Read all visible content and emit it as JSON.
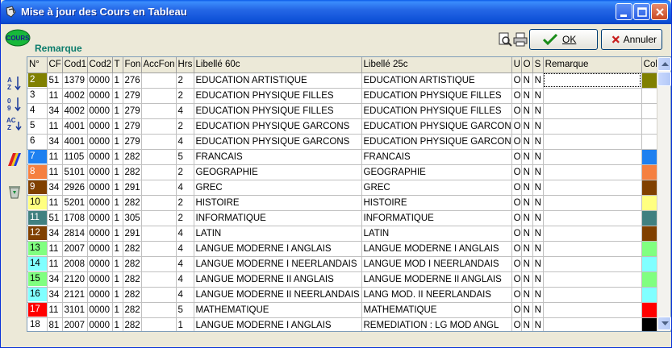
{
  "window": {
    "title": "Mise à jour des Cours en Tableau",
    "logo_text": "COURS",
    "section_label": "Remarque"
  },
  "toolbar": {
    "ok_label": "OK",
    "cancel_label": "Annuler",
    "preview_icon": "print-preview-icon",
    "print_icon": "printer-icon"
  },
  "side_tools": [
    {
      "name": "sort-alpha-icon"
    },
    {
      "name": "sort-numeric-icon"
    },
    {
      "name": "sort-ac-icon"
    },
    {
      "name": "color-palette-icon"
    },
    {
      "name": "recycle-bin-icon"
    }
  ],
  "columns": [
    "N°",
    "CF",
    "Cod1",
    "Cod2",
    "T",
    "Fon",
    "AccFon",
    "Hrs",
    "Libellé 60c",
    "Libellé 25c",
    "U",
    "O",
    "S",
    "Remarque",
    "Col"
  ],
  "rows": [
    {
      "n": "2",
      "cf": "51",
      "cod1": "1379",
      "cod2": "0000",
      "t": "1",
      "fon": "276",
      "accfon": "",
      "hrs": "2",
      "lib60": "EDUCATION ARTISTIQUE",
      "lib25": "EDUCATION ARTISTIQUE",
      "u": "O",
      "o": "N",
      "s": "N",
      "remarque": "",
      "color": "#808000",
      "ntext": "#ffffff"
    },
    {
      "n": "3",
      "cf": "11",
      "cod1": "4002",
      "cod2": "0000",
      "t": "1",
      "fon": "279",
      "accfon": "",
      "hrs": "2",
      "lib60": "EDUCATION PHYSIQUE FILLES",
      "lib25": "EDUCATION PHYSIQUE FILLES",
      "u": "O",
      "o": "N",
      "s": "N",
      "remarque": "",
      "color": "#ffffff",
      "ntext": "#000000"
    },
    {
      "n": "4",
      "cf": "34",
      "cod1": "4002",
      "cod2": "0000",
      "t": "1",
      "fon": "279",
      "accfon": "",
      "hrs": "4",
      "lib60": "EDUCATION PHYSIQUE FILLES",
      "lib25": "EDUCATION PHYSIQUE FILLES",
      "u": "O",
      "o": "N",
      "s": "N",
      "remarque": "",
      "color": "#ffffff",
      "ntext": "#000000"
    },
    {
      "n": "5",
      "cf": "11",
      "cod1": "4001",
      "cod2": "0000",
      "t": "1",
      "fon": "279",
      "accfon": "",
      "hrs": "2",
      "lib60": "EDUCATION PHYSIQUE GARCONS",
      "lib25": "EDUCATION PHYSIQUE GARCON",
      "u": "O",
      "o": "N",
      "s": "N",
      "remarque": "",
      "color": "#ffffff",
      "ntext": "#000000"
    },
    {
      "n": "6",
      "cf": "34",
      "cod1": "4001",
      "cod2": "0000",
      "t": "1",
      "fon": "279",
      "accfon": "",
      "hrs": "4",
      "lib60": "EDUCATION PHYSIQUE GARCONS",
      "lib25": "EDUCATION PHYSIQUE GARCON",
      "u": "O",
      "o": "N",
      "s": "N",
      "remarque": "",
      "color": "#ffffff",
      "ntext": "#000000"
    },
    {
      "n": "7",
      "cf": "11",
      "cod1": "1105",
      "cod2": "0000",
      "t": "1",
      "fon": "282",
      "accfon": "",
      "hrs": "5",
      "lib60": "FRANCAIS",
      "lib25": "FRANCAIS",
      "u": "O",
      "o": "N",
      "s": "N",
      "remarque": "",
      "color": "#1e80f0",
      "ntext": "#ffffff"
    },
    {
      "n": "8",
      "cf": "11",
      "cod1": "5101",
      "cod2": "0000",
      "t": "1",
      "fon": "282",
      "accfon": "",
      "hrs": "2",
      "lib60": "GEOGRAPHIE",
      "lib25": "GEOGRAPHIE",
      "u": "O",
      "o": "N",
      "s": "N",
      "remarque": "",
      "color": "#f58040",
      "ntext": "#ffffff"
    },
    {
      "n": "9",
      "cf": "34",
      "cod1": "2926",
      "cod2": "0000",
      "t": "1",
      "fon": "291",
      "accfon": "",
      "hrs": "4",
      "lib60": "GREC",
      "lib25": "GREC",
      "u": "O",
      "o": "N",
      "s": "N",
      "remarque": "",
      "color": "#804000",
      "ntext": "#ffffff"
    },
    {
      "n": "10",
      "cf": "11",
      "cod1": "5201",
      "cod2": "0000",
      "t": "1",
      "fon": "282",
      "accfon": "",
      "hrs": "2",
      "lib60": "HISTOIRE",
      "lib25": "HISTOIRE",
      "u": "O",
      "o": "N",
      "s": "N",
      "remarque": "",
      "color": "#ffff80",
      "ntext": "#000000"
    },
    {
      "n": "11",
      "cf": "51",
      "cod1": "1708",
      "cod2": "0000",
      "t": "1",
      "fon": "305",
      "accfon": "",
      "hrs": "2",
      "lib60": "INFORMATIQUE",
      "lib25": "INFORMATIQUE",
      "u": "O",
      "o": "N",
      "s": "N",
      "remarque": "",
      "color": "#408080",
      "ntext": "#ffffff"
    },
    {
      "n": "12",
      "cf": "34",
      "cod1": "2814",
      "cod2": "0000",
      "t": "1",
      "fon": "291",
      "accfon": "",
      "hrs": "4",
      "lib60": "LATIN",
      "lib25": "LATIN",
      "u": "O",
      "o": "N",
      "s": "N",
      "remarque": "",
      "color": "#804000",
      "ntext": "#ffffff"
    },
    {
      "n": "13",
      "cf": "11",
      "cod1": "2007",
      "cod2": "0000",
      "t": "1",
      "fon": "282",
      "accfon": "",
      "hrs": "4",
      "lib60": "LANGUE MODERNE I ANGLAIS",
      "lib25": "LANGUE MODERNE I ANGLAIS",
      "u": "O",
      "o": "N",
      "s": "N",
      "remarque": "",
      "color": "#80ff80",
      "ntext": "#000000"
    },
    {
      "n": "14",
      "cf": "11",
      "cod1": "2008",
      "cod2": "0000",
      "t": "1",
      "fon": "282",
      "accfon": "",
      "hrs": "4",
      "lib60": "LANGUE MODERNE I NEERLANDAIS",
      "lib25": "LANGUE MOD I NEERLANDAIS",
      "u": "O",
      "o": "N",
      "s": "N",
      "remarque": "",
      "color": "#80ffff",
      "ntext": "#000000"
    },
    {
      "n": "15",
      "cf": "34",
      "cod1": "2120",
      "cod2": "0000",
      "t": "1",
      "fon": "282",
      "accfon": "",
      "hrs": "4",
      "lib60": "LANGUE MODERNE II ANGLAIS",
      "lib25": "LANGUE MODERNE II ANGLAIS",
      "u": "O",
      "o": "N",
      "s": "N",
      "remarque": "",
      "color": "#80ff80",
      "ntext": "#000000"
    },
    {
      "n": "16",
      "cf": "34",
      "cod1": "2121",
      "cod2": "0000",
      "t": "1",
      "fon": "282",
      "accfon": "",
      "hrs": "4",
      "lib60": "LANGUE MODERNE II NEERLANDAIS",
      "lib25": "LANG MOD. II NEERLANDAIS",
      "u": "O",
      "o": "N",
      "s": "N",
      "remarque": "",
      "color": "#80ffff",
      "ntext": "#000000"
    },
    {
      "n": "17",
      "cf": "11",
      "cod1": "3101",
      "cod2": "0000",
      "t": "1",
      "fon": "282",
      "accfon": "",
      "hrs": "5",
      "lib60": "MATHEMATIQUE",
      "lib25": "MATHEMATIQUE",
      "u": "O",
      "o": "N",
      "s": "N",
      "remarque": "",
      "color": "#ff0000",
      "ntext": "#ffffff"
    },
    {
      "n": "18",
      "cf": "81",
      "cod1": "2007",
      "cod2": "0000",
      "t": "1",
      "fon": "282",
      "accfon": "",
      "hrs": "1",
      "lib60": "LANGUE MODERNE I ANGLAIS",
      "lib25": "REMEDIATION : LG MOD ANGL",
      "u": "O",
      "o": "N",
      "s": "N",
      "remarque": "",
      "color": "#000000",
      "ntext": "#000000"
    }
  ]
}
